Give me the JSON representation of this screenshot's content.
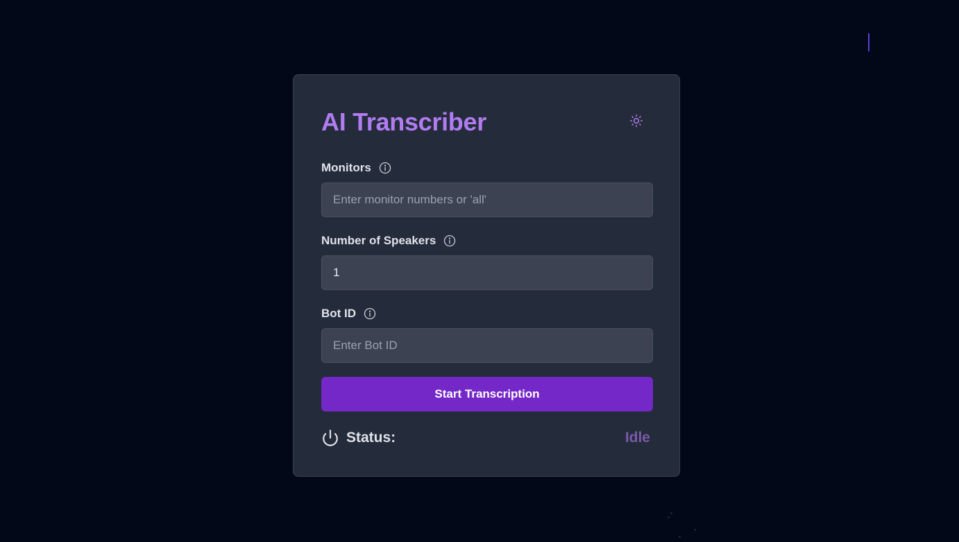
{
  "app": {
    "title": "AI Transcriber"
  },
  "icons": {
    "theme_toggle": "sun-icon",
    "info": "info-icon",
    "power": "power-icon"
  },
  "fields": {
    "monitors": {
      "label": "Monitors",
      "value": "",
      "placeholder": "Enter monitor numbers or 'all'"
    },
    "speakers": {
      "label": "Number of Speakers",
      "value": "1",
      "placeholder": ""
    },
    "bot_id": {
      "label": "Bot ID",
      "value": "",
      "placeholder": "Enter Bot ID"
    }
  },
  "actions": {
    "start_label": "Start Transcription"
  },
  "status": {
    "label": "Status:",
    "value": "Idle"
  },
  "colors": {
    "background": "#020817",
    "card": "#242b3a",
    "title": "#b07cf0",
    "button": "#7528c8",
    "status_value": "#7a5aa8"
  }
}
